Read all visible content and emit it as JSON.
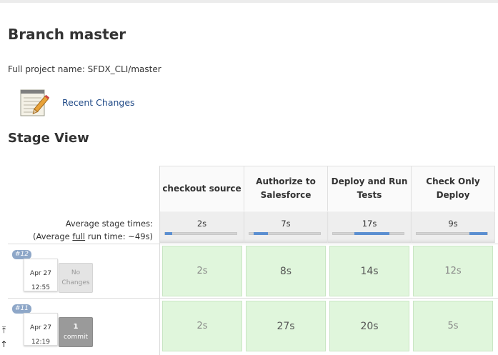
{
  "page": {
    "title": "Branch master",
    "full_name": "Full project name: SFDX_CLI/master",
    "recent_changes": "Recent Changes",
    "stage_view_title": "Stage View"
  },
  "stage_view": {
    "avg_label_line1": "Average stage times:",
    "avg_label_pre": "(Average ",
    "avg_label_link": "full",
    "avg_label_post": " run time: ~49s)",
    "stages": [
      {
        "name": "checkout source",
        "avg": "2s",
        "progress": 0.1
      },
      {
        "name": "Authorize to Salesforce",
        "avg": "7s",
        "progress": 0.2
      },
      {
        "name": "Deploy and Run Tests",
        "avg": "17s",
        "progress": 0.5
      },
      {
        "name": "Check Only Deploy",
        "avg": "9s",
        "progress": 0.25
      }
    ],
    "builds": [
      {
        "number": "#12",
        "date": "Apr 27",
        "time": "12:55",
        "changes_line1": "No",
        "changes_line2": "Changes",
        "durations": [
          "2s",
          "8s",
          "14s",
          "12s"
        ]
      },
      {
        "number": "#11",
        "date": "Apr 27",
        "time": "12:19",
        "changes_line1": "1",
        "changes_line2": "commit",
        "durations": [
          "2s",
          "27s",
          "20s",
          "5s"
        ]
      }
    ]
  },
  "colors": {
    "link": "#204a87",
    "success_cell": "#e0f6dc",
    "progress": "#5b8fd1"
  }
}
